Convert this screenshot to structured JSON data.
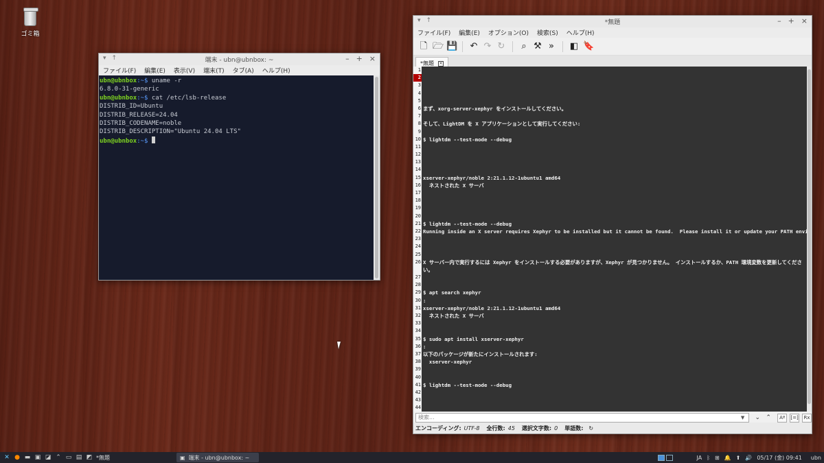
{
  "desktop": {
    "trash_label": "ゴミ箱"
  },
  "terminal": {
    "title": "端末 - ubn@ubnbox: ~",
    "menu": [
      "ファイル(F)",
      "編集(E)",
      "表示(V)",
      "端末(T)",
      "タブ(A)",
      "ヘルプ(H)"
    ],
    "lines": [
      {
        "user": "ubn@ubnbox",
        "path": ":~$",
        "cmd": " uname -r"
      },
      {
        "out": "6.8.0-31-generic"
      },
      {
        "user": "ubn@ubnbox",
        "path": ":~$",
        "cmd": " cat /etc/lsb-release"
      },
      {
        "out": "DISTRIB_ID=Ubuntu"
      },
      {
        "out": "DISTRIB_RELEASE=24.04"
      },
      {
        "out": "DISTRIB_CODENAME=noble"
      },
      {
        "out": "DISTRIB_DESCRIPTION=\"Ubuntu 24.04 LTS\""
      },
      {
        "user": "ubn@ubnbox",
        "path": ":~$",
        "cmd": " ",
        "cursor": true
      }
    ]
  },
  "editor": {
    "title": "*無題",
    "menu": [
      "ファイル(F)",
      "編集(E)",
      "オプション(O)",
      "検索(S)",
      "ヘルプ(H)"
    ],
    "tab_label": "*無題",
    "current_line": "2",
    "lines": [
      "",
      "",
      "",
      "",
      "",
      "まず、xorg-server-xephyr をインストールしてください。",
      "",
      "そして、LightDM を X アプリケーションとして実行してください:",
      "",
      "$ lightdm --test-mode --debug",
      "",
      "",
      "",
      "",
      "xserver-xephyr/noble 2:21.1.12-1ubuntu1 amd64",
      "  ネストされた X サーバ",
      "",
      "",
      "",
      "",
      "$ lightdm --test-mode --debug",
      "Running inside an X server requires Xephyr to be installed but it cannot be found.  Please install it or update your PATH environment variable.",
      "",
      "",
      "",
      "X サーバー内で実行するには Xephyr をインストールする必要がありますが、Xephyr が見つかりません。 インストールするか、PATH 環境変数を更新してくださ",
      "い。",
      "",
      "",
      "$ apt search xephyr",
      ":",
      "xserver-xephyr/noble 2:21.1.12-1ubuntu1 amd64",
      "  ネストされた X サーバ",
      "",
      "",
      "$ sudo apt install xserver-xephyr",
      ":",
      "以下のパッケージが新たにインストールされます:",
      "  xserver-xephyr",
      "",
      "",
      "$ lightdm --test-mode --debug",
      "",
      "",
      ""
    ],
    "gutter": [
      "1",
      "2",
      "3",
      "4",
      "5",
      "6",
      "7",
      "8",
      "9",
      "10",
      "11",
      "12",
      "13",
      "14",
      "15",
      "16",
      "17",
      "18",
      "19",
      "20",
      "21",
      "22",
      "23",
      "24",
      "25",
      "26",
      "",
      "27",
      "28",
      "29",
      "30",
      "31",
      "32",
      "33",
      "34",
      "35",
      "36",
      "37",
      "38",
      "39",
      "40",
      "41",
      "42",
      "43",
      "44"
    ],
    "search_placeholder": "検索...",
    "status": {
      "encoding_label": "エンコーディング:",
      "encoding_value": "UTF-8",
      "lines_label": "全行数:",
      "lines_value": "45",
      "selected_label": "選択文字数:",
      "selected_value": "0",
      "words_label": "単語数:"
    }
  },
  "taskbar": {
    "tasks": [
      "*無題",
      "端末 - ubn@ubnbox: ~"
    ],
    "lang": "JA",
    "clock": "05/17 (金) 09:41",
    "user": "ubn"
  }
}
